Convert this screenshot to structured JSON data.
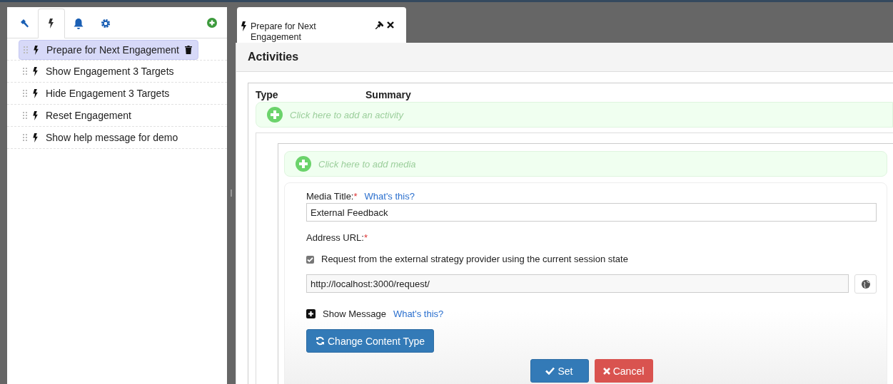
{
  "sidebar": {
    "tabs": [
      {
        "selected": false
      },
      {
        "selected": true
      },
      {
        "selected": false
      },
      {
        "selected": false
      }
    ],
    "items": [
      {
        "label": "Prepare for Next Engagement",
        "selected": true
      },
      {
        "label": "Show Engagement 3 Targets",
        "selected": false
      },
      {
        "label": "Hide Engagement 3 Targets",
        "selected": false
      },
      {
        "label": "Reset Engagement",
        "selected": false
      },
      {
        "label": "Show help message for demo",
        "selected": false
      }
    ]
  },
  "editor_tab": {
    "title": "Prepare for Next Engagement"
  },
  "panel": {
    "title": "Activities",
    "columns": [
      "Type",
      "Summary"
    ],
    "add_activity": {
      "label": "Click here to add an activity"
    },
    "add_media": {
      "label": "Click here to add media"
    },
    "form": {
      "media_title_label": "Media Title:",
      "required_mark": "*",
      "help_link": "What's this?",
      "media_title_value": "External Feedback",
      "address_label": "Address URL:",
      "address_required_mark": "*",
      "request_option": {
        "label": "Request from the external strategy provider using the current session state",
        "checked": true
      },
      "url_value": "http://localhost:3000/request/",
      "show_message": {
        "label": "Show Message",
        "expanded": false,
        "help_link": "What's this?"
      },
      "change_button": "Change Content Type",
      "set_button": "Set",
      "cancel_button": "Cancel"
    }
  }
}
